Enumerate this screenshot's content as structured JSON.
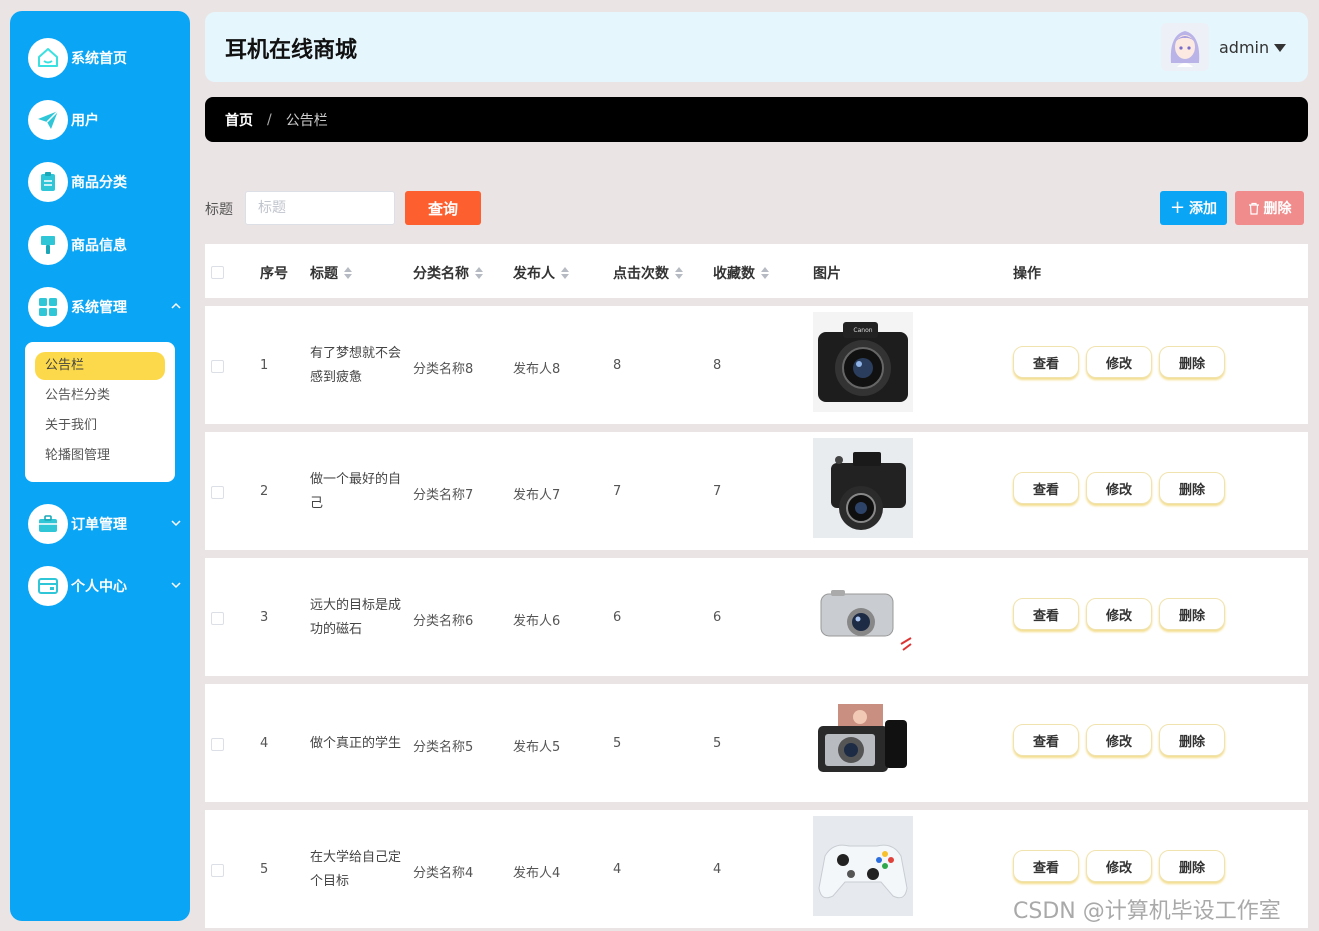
{
  "sidebar": {
    "items": [
      {
        "label": "系统首页",
        "icon": "home-icon"
      },
      {
        "label": "用户",
        "icon": "paper-plane-icon"
      },
      {
        "label": "商品分类",
        "icon": "clipboard-icon"
      },
      {
        "label": "商品信息",
        "icon": "brush-icon"
      },
      {
        "label": "系统管理",
        "icon": "grid-icon"
      },
      {
        "label": "订单管理",
        "icon": "briefcase-icon"
      },
      {
        "label": "个人中心",
        "icon": "card-icon"
      }
    ],
    "submenu": [
      "公告栏",
      "公告栏分类",
      "关于我们",
      "轮播图管理"
    ]
  },
  "header": {
    "title": "耳机在线商城",
    "user": "admin"
  },
  "breadcrumb": {
    "home": "首页",
    "separator": "/",
    "current": "公告栏"
  },
  "search": {
    "label": "标题",
    "placeholder": "标题",
    "query_label": "查询",
    "add_label": "添加",
    "delete_label": "删除"
  },
  "table": {
    "columns": [
      "序号",
      "标题",
      "分类名称",
      "发布人",
      "点击次数",
      "收藏数",
      "图片",
      "操作"
    ],
    "actions": [
      "查看",
      "修改",
      "删除"
    ],
    "rows": [
      {
        "index": "1",
        "title": "有了梦想就不会感到疲惫",
        "category": "分类名称8",
        "publisher": "发布人8",
        "clicks": "8",
        "favorites": "8",
        "image": "camera-dslr"
      },
      {
        "index": "2",
        "title": "做一个最好的自己",
        "category": "分类名称7",
        "publisher": "发布人7",
        "clicks": "7",
        "favorites": "7",
        "image": "camera-retro"
      },
      {
        "index": "3",
        "title": "远大的目标是成功的磁石",
        "category": "分类名称6",
        "publisher": "发布人6",
        "clicks": "6",
        "favorites": "6",
        "image": "camera-compact"
      },
      {
        "index": "4",
        "title": "做个真正的学生",
        "category": "分类名称5",
        "publisher": "发布人5",
        "clicks": "5",
        "favorites": "5",
        "image": "camera-mirrorless"
      },
      {
        "index": "5",
        "title": "在大学给自己定个目标",
        "category": "分类名称4",
        "publisher": "发布人4",
        "clicks": "4",
        "favorites": "4",
        "image": "game-controller"
      }
    ]
  },
  "watermark": "CSDN @计算机毕设工作室",
  "colors": {
    "primary": "#0aa5f5",
    "query": "#fd5f2e",
    "danger": "#f08c8c",
    "active_sub": "#fcd94a"
  }
}
